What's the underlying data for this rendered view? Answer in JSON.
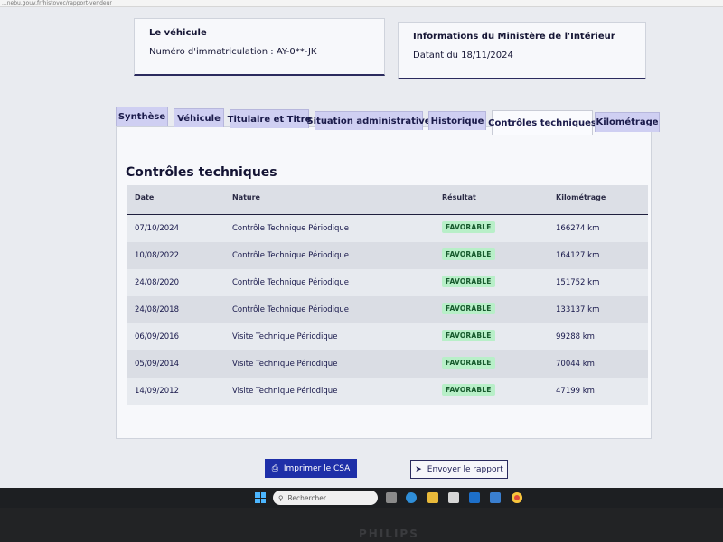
{
  "browser": {
    "url_text": "...nebu.gouv.fr/histovec/rapport-vendeur"
  },
  "vehicle_box": {
    "title": "Le véhicule",
    "registration": "Numéro d'immatriculation : AY-0**-JK"
  },
  "ministry_box": {
    "title": "Informations du Ministère de l'Intérieur",
    "date": "Datant du 18/11/2024"
  },
  "tabs": [
    {
      "label": "Synthèse",
      "active": false
    },
    {
      "label": "Véhicule",
      "active": false
    },
    {
      "label": "Titulaire et Titre",
      "active": false
    },
    {
      "label": "Situation administrative",
      "active": false
    },
    {
      "label": "Historique",
      "active": false
    },
    {
      "label": "Contrôles techniques",
      "active": true
    },
    {
      "label": "Kilométrage",
      "active": false
    }
  ],
  "section": {
    "title": "Contrôles techniques",
    "columns": {
      "date": "Date",
      "nature": "Nature",
      "result": "Résultat",
      "km": "Kilométrage"
    },
    "rows": [
      {
        "date": "07/10/2024",
        "nature": "Contrôle Technique Périodique",
        "result": "FAVORABLE",
        "km": "166274 km"
      },
      {
        "date": "10/08/2022",
        "nature": "Contrôle Technique Périodique",
        "result": "FAVORABLE",
        "km": "164127 km"
      },
      {
        "date": "24/08/2020",
        "nature": "Contrôle Technique Périodique",
        "result": "FAVORABLE",
        "km": "151752 km"
      },
      {
        "date": "24/08/2018",
        "nature": "Contrôle Technique Périodique",
        "result": "FAVORABLE",
        "km": "133137 km"
      },
      {
        "date": "06/09/2016",
        "nature": "Visite Technique Périodique",
        "result": "FAVORABLE",
        "km": "99288 km"
      },
      {
        "date": "05/09/2014",
        "nature": "Visite Technique Périodique",
        "result": "FAVORABLE",
        "km": "70044 km"
      },
      {
        "date": "14/09/2012",
        "nature": "Visite Technique Périodique",
        "result": "FAVORABLE",
        "km": "47199 km"
      }
    ]
  },
  "actions": {
    "print_label": "Imprimer le CSA",
    "send_label": "Envoyer le rapport"
  },
  "taskbar": {
    "search_placeholder": "Rechercher",
    "apps": [
      "task-view-icon",
      "edge-icon",
      "file-explorer-icon",
      "calendar-icon",
      "outlook-icon",
      "store-icon",
      "chrome-icon"
    ]
  },
  "monitor": {
    "brand": "PHILIPS"
  },
  "colors": {
    "tab_inactive": "#cfcff2",
    "badge_bg": "#b8efc8",
    "badge_text": "#175a2d",
    "primary_button": "#1e2fa8"
  }
}
